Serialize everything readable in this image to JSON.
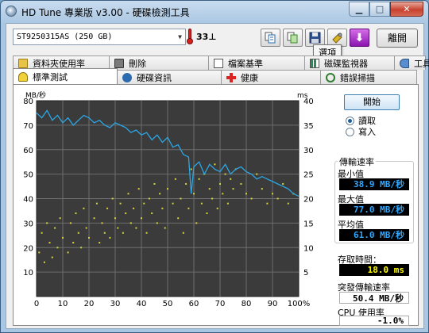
{
  "window": {
    "title": "HD Tune 專業版 v3.00 - 硬碟檢測工具"
  },
  "header": {
    "drive": "ST9250315AS  (250 GB)",
    "temperature": "33",
    "temp_unit_glyph": "⊥",
    "exit_label": "離開",
    "tooltip": "選項",
    "toolbar_icons": [
      "copy-text-icon",
      "copy-screenshot-icon",
      "save-icon",
      "options-icon",
      "download-icon"
    ]
  },
  "tabs_top": [
    "資料夾使用率",
    "刪除",
    "檔案基準",
    "磁碟監視器",
    "工具"
  ],
  "tabs_bottom": [
    "標準測試",
    "硬碟資訊",
    "健康",
    "錯誤掃描"
  ],
  "controls": {
    "start_label": "開始",
    "read_label": "讀取",
    "write_label": "寫入",
    "mode_selected": "read"
  },
  "stats": {
    "group_title": "傳輸速率",
    "min_label": "最小值",
    "min_value": "38.9 MB/秒",
    "max_label": "最大值",
    "max_value": "77.0 MB/秒",
    "avg_label": "平均值",
    "avg_value": "61.0 MB/秒",
    "access_label": "存取時間：",
    "access_value": "18.0 ms",
    "burst_label": "突發傳輸速率",
    "burst_value": "50.4 MB/秒",
    "cpu_label": "CPU 使用率",
    "cpu_value": "-1.0%"
  },
  "colors": {
    "transfer_line": "#2aa7e6",
    "access_points": "#d4d43a",
    "grid": "#6e6e6e",
    "plot_bg": "#3b3b3b"
  },
  "chart_data": {
    "type": "line",
    "y_left_unit": "MB/秒",
    "y_right_unit": "ms",
    "ylim_left": [
      0,
      80
    ],
    "ylim_right": [
      0,
      40
    ],
    "xlim": [
      0,
      100
    ],
    "x_ticks": [
      "0",
      "10",
      "20",
      "30",
      "40",
      "50",
      "60",
      "70",
      "80",
      "90",
      "100%"
    ],
    "y_left_ticks": [
      "80",
      "70",
      "60",
      "50",
      "40",
      "30",
      "20",
      "10"
    ],
    "y_right_ticks": [
      "40",
      "35",
      "30",
      "25",
      "20",
      "15",
      "10",
      "5"
    ],
    "series": [
      {
        "x": [
          0,
          2,
          4,
          6,
          8,
          10,
          12,
          14,
          16,
          18,
          20,
          22,
          24,
          26,
          28,
          30,
          32,
          34,
          36,
          38,
          40,
          42,
          44,
          46,
          48,
          50,
          52,
          54,
          56,
          58,
          59,
          60,
          62,
          64,
          66,
          68,
          70,
          72,
          74,
          76,
          78,
          80,
          82,
          84,
          86,
          88,
          90,
          92,
          94,
          96,
          98,
          100
        ],
        "values": [
          75,
          73,
          76,
          72,
          74,
          71,
          73,
          70,
          72,
          74,
          73,
          71,
          72,
          70,
          69,
          71,
          70,
          69,
          67,
          68,
          66,
          67,
          64,
          66,
          63,
          65,
          61,
          62,
          58,
          57,
          42,
          53,
          55,
          50,
          54,
          52,
          51,
          54,
          50,
          52,
          53,
          51,
          50,
          48,
          49,
          48,
          47,
          46,
          45,
          44,
          42,
          41
        ]
      }
    ],
    "scatter": {
      "axis": "right",
      "x": [
        1,
        2,
        3,
        4,
        5,
        6,
        7,
        8,
        9,
        10,
        12,
        13,
        14,
        15,
        16,
        17,
        18,
        19,
        20,
        22,
        23,
        24,
        25,
        26,
        27,
        28,
        29,
        30,
        31,
        32,
        33,
        34,
        35,
        36,
        37,
        38,
        39,
        40,
        41,
        42,
        43,
        44,
        45,
        46,
        47,
        48,
        49,
        50,
        52,
        53,
        54,
        55,
        56,
        57,
        58,
        59,
        60,
        61,
        62,
        63,
        64,
        65,
        66,
        67,
        68,
        69,
        70,
        71,
        72,
        73,
        74,
        75,
        76,
        78,
        80,
        82,
        84,
        86,
        88,
        90,
        92,
        94,
        96,
        98
      ],
      "values": [
        9,
        13,
        7,
        15,
        11,
        8,
        14,
        10,
        16,
        12,
        9,
        15,
        11,
        17,
        13,
        10,
        18,
        14,
        12,
        16,
        19,
        11,
        15,
        13,
        18,
        12,
        20,
        16,
        14,
        19,
        13,
        17,
        21,
        15,
        18,
        14,
        22,
        16,
        19,
        13,
        20,
        17,
        23,
        15,
        21,
        18,
        14,
        22,
        19,
        24,
        16,
        20,
        13,
        23,
        18,
        26,
        21,
        15,
        24,
        19,
        25,
        17,
        22,
        20,
        27,
        18,
        23,
        21,
        25,
        19,
        24,
        22,
        26,
        23,
        21,
        20,
        25,
        22,
        19,
        21,
        20,
        23,
        19,
        21
      ]
    },
    "grid": true
  }
}
